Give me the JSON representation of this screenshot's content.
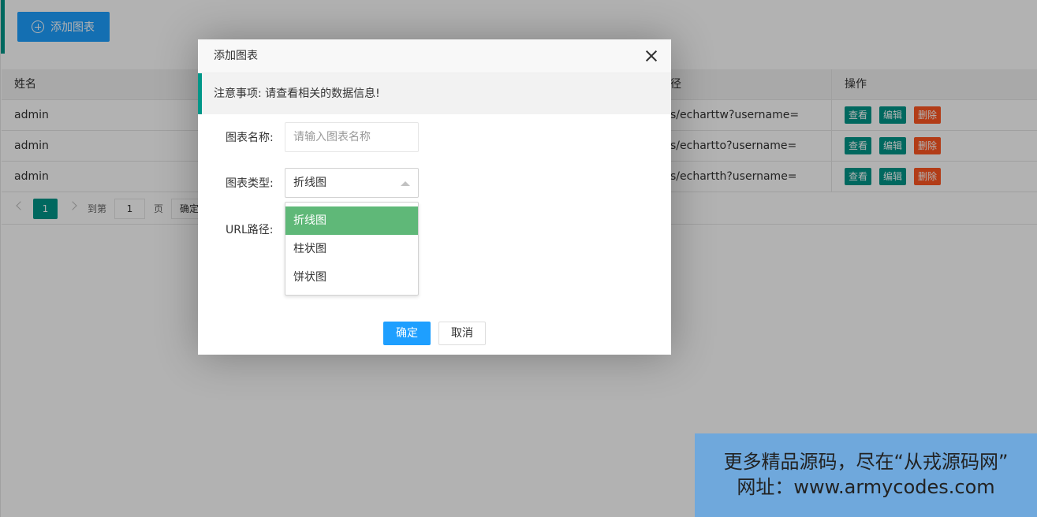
{
  "toolbar": {
    "add_label": "添加图表"
  },
  "table": {
    "headers": {
      "name": "姓名",
      "url": "径",
      "ops": "操作"
    },
    "rows": [
      {
        "name": "admin",
        "url": "s/echarttw?username="
      },
      {
        "name": "admin",
        "url": "s/echartto?username="
      },
      {
        "name": "admin",
        "url": "s/echartth?username="
      }
    ],
    "ops": {
      "view": "查看",
      "edit": "编辑",
      "delete": "删除"
    }
  },
  "pager": {
    "current": "1",
    "goto": "到第",
    "input": "1",
    "page": "页",
    "ok": "确定"
  },
  "modal": {
    "title": "添加图表",
    "notice": "注意事项: 请查看相关的数据信息!",
    "name_label": "图表名称:",
    "name_placeholder": "请输入图表名称",
    "type_label": "图表类型:",
    "type_value": "折线图",
    "url_label": "URL路径:",
    "options": [
      "折线图",
      "柱状图",
      "饼状图"
    ],
    "ok": "确定",
    "cancel": "取消"
  },
  "watermark": {
    "line1": "更多精品源码，尽在“从戎源码网”",
    "line2": "网址：www.armycodes.com"
  },
  "colors": {
    "teal": "#009688",
    "blue": "#1e9fff",
    "red": "#ff5722",
    "green": "#5fb878"
  }
}
